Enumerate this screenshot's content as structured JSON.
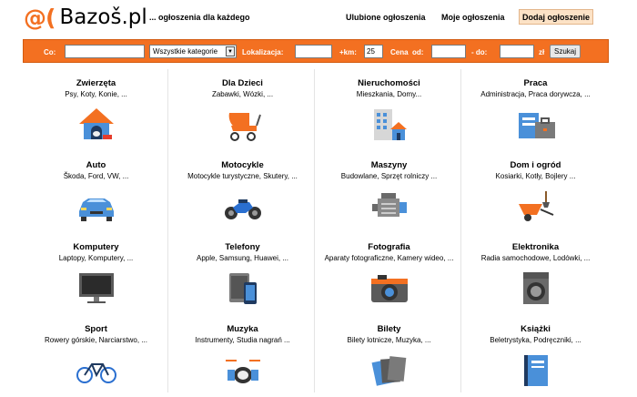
{
  "header": {
    "logo_at": "@(",
    "logo_name": "Bazoš.pl",
    "tagline": "... ogłoszenia dla każdego",
    "links": [
      "Ulubione ogłoszenia",
      "Moje ogłoszenia"
    ],
    "add_button": "Dodaj ogłoszenie"
  },
  "search": {
    "co_label": "Co:",
    "co_value": "",
    "category_selected": "Wszystkie kategorie",
    "location_label": "Lokalizacja:",
    "location_value": "",
    "km_label": "+km:",
    "km_value": "25",
    "price_label": "Cena  od:",
    "price_from": "",
    "price_to_label": "- do:",
    "price_to": "",
    "currency": "zł",
    "submit": "Szukaj"
  },
  "categories": [
    {
      "title": "Zwierzęta",
      "subtitle": "Psy, Koty, Konie, ...",
      "icon": "dog-house-icon"
    },
    {
      "title": "Dla Dzieci",
      "subtitle": "Zabawki, Wózki, ...",
      "icon": "stroller-icon"
    },
    {
      "title": "Nieruchomości",
      "subtitle": "Mieszkania, Domy...",
      "icon": "buildings-icon"
    },
    {
      "title": "Praca",
      "subtitle": "Administracja, Praca dorywcza, ...",
      "icon": "briefcase-icon"
    },
    {
      "title": "Auto",
      "subtitle": "Škoda, Ford, VW, ...",
      "icon": "car-icon"
    },
    {
      "title": "Motocykle",
      "subtitle": "Motocykle turystyczne, Skutery, ...",
      "icon": "motorcycle-icon"
    },
    {
      "title": "Maszyny",
      "subtitle": "Budowlane, Sprzęt rolniczy ...",
      "icon": "engine-icon"
    },
    {
      "title": "Dom i ogród",
      "subtitle": "Kosiarki, Kotły, Bojlery ...",
      "icon": "wheelbarrow-icon"
    },
    {
      "title": "Komputery",
      "subtitle": "Laptopy, Komputery, ...",
      "icon": "monitor-icon"
    },
    {
      "title": "Telefony",
      "subtitle": "Apple, Samsung, Huawei, ...",
      "icon": "phone-icon"
    },
    {
      "title": "Fotografia",
      "subtitle": "Aparaty fotograficzne, Kamery wideo, ...",
      "icon": "camera-icon"
    },
    {
      "title": "Elektronika",
      "subtitle": "Radia samochodowe, Lodówki, ...",
      "icon": "washing-machine-icon"
    },
    {
      "title": "Sport",
      "subtitle": "Rowery górskie, Narciarstwo, ...",
      "icon": "bicycle-icon"
    },
    {
      "title": "Muzyka",
      "subtitle": "Instrumenty, Studia nagrań ...",
      "icon": "drums-icon"
    },
    {
      "title": "Bilety",
      "subtitle": "Bilety lotnicze, Muzyka, ...",
      "icon": "tickets-icon"
    },
    {
      "title": "Książki",
      "subtitle": "Beletrystyka, Podręczniki, ...",
      "icon": "book-icon"
    }
  ],
  "colors": {
    "brand": "#f37021",
    "add_button_bg": "#fce2c6"
  }
}
